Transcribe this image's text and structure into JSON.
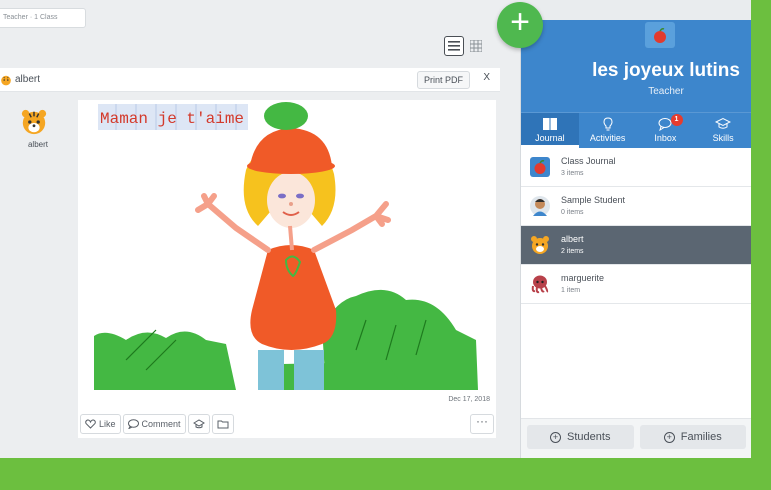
{
  "breadcrumb": "Teacher · 1 Class",
  "student_header": {
    "name": "albert",
    "print_label": "Print PDF",
    "close_label": "X"
  },
  "side_student": {
    "name": "albert"
  },
  "post": {
    "drawing_text": "Maman je t'aime",
    "date": "Dec 17, 2018",
    "like_label": "Like",
    "comment_label": "Comment",
    "more_label": "···"
  },
  "class_panel": {
    "title": "les joyeux lutins",
    "role": "Teacher",
    "tabs": [
      {
        "label": "Journal",
        "icon": "journal-icon"
      },
      {
        "label": "Activities",
        "icon": "lightbulb-icon"
      },
      {
        "label": "Inbox",
        "icon": "chat-icon",
        "badge": "1"
      },
      {
        "label": "Skills",
        "icon": "mortarboard-icon"
      }
    ],
    "items": [
      {
        "title": "Class Journal",
        "count": "3 items",
        "icon": "apple-icon"
      },
      {
        "title": "Sample Student",
        "count": "0 items",
        "icon": "student-avatar-icon"
      },
      {
        "title": "albert",
        "count": "2 items",
        "icon": "tiger-avatar-icon"
      },
      {
        "title": "marguerite",
        "count": "1 item",
        "icon": "octopus-avatar-icon"
      }
    ],
    "footer": {
      "students_label": "Students",
      "families_label": "Families"
    }
  },
  "colors": {
    "brand_green": "#6cbf3f",
    "panel_blue": "#3d86cc",
    "selected_row": "#5b6672",
    "badge_red": "#e53c2e"
  }
}
